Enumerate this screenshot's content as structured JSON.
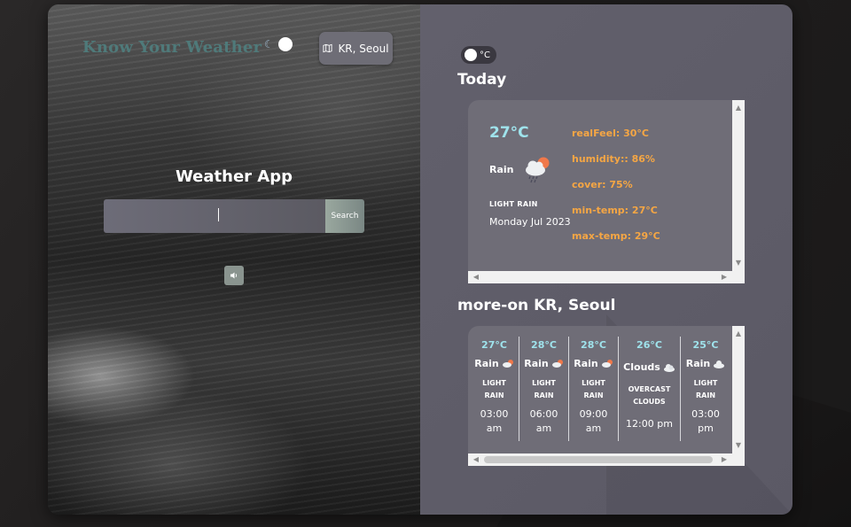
{
  "brand": {
    "title": "Know Your Weather"
  },
  "theme_toggle": {
    "icon": "moon-icon"
  },
  "location_button": {
    "label": "KR, Seoul",
    "icon": "map-icon"
  },
  "app": {
    "title": "Weather App"
  },
  "search": {
    "input_value": "",
    "button_label": "Search"
  },
  "voice_button": {
    "icon": "speaker-icon"
  },
  "unit_toggle": {
    "label": "°C"
  },
  "today": {
    "section_title": "Today",
    "temperature": "27°C",
    "condition": "Rain",
    "description": "LIGHT RAIN",
    "date": "Monday Jul 2023",
    "stats": [
      "realFeel: 30°C",
      "humidity:: 86%",
      "cover: 75%",
      "min-temp: 27°C",
      "max-temp: 29°C"
    ]
  },
  "forecast": {
    "section_title": "more-on KR, Seoul",
    "items": [
      {
        "temp": "27°C",
        "condition": "Rain",
        "desc_line1": "LIGHT",
        "desc_line2": "RAIN",
        "time_line1": "03:00",
        "time_line2": "am",
        "icon": "rain-cloud-icon"
      },
      {
        "temp": "28°C",
        "condition": "Rain",
        "desc_line1": "LIGHT",
        "desc_line2": "RAIN",
        "time_line1": "06:00",
        "time_line2": "am",
        "icon": "rain-cloud-icon"
      },
      {
        "temp": "28°C",
        "condition": "Rain",
        "desc_line1": "LIGHT",
        "desc_line2": "RAIN",
        "time_line1": "09:00",
        "time_line2": "am",
        "icon": "rain-cloud-icon"
      },
      {
        "temp": "26°C",
        "condition": "Clouds",
        "desc_line1": "OVERCAST",
        "desc_line2": "CLOUDS",
        "time_line1": "12:00 pm",
        "time_line2": "",
        "icon": "cloud-icon"
      },
      {
        "temp": "25°C",
        "condition": "Rain",
        "desc_line1": "LIGHT",
        "desc_line2": "RAIN",
        "time_line1": "03:00",
        "time_line2": "pm",
        "icon": "rain-cloud-icon"
      }
    ]
  },
  "colors": {
    "accent_temp": "#9fe3ec",
    "stat_orange": "#f5a644",
    "panel_bg": "#6f6d77",
    "right_bg": "#62606c"
  }
}
